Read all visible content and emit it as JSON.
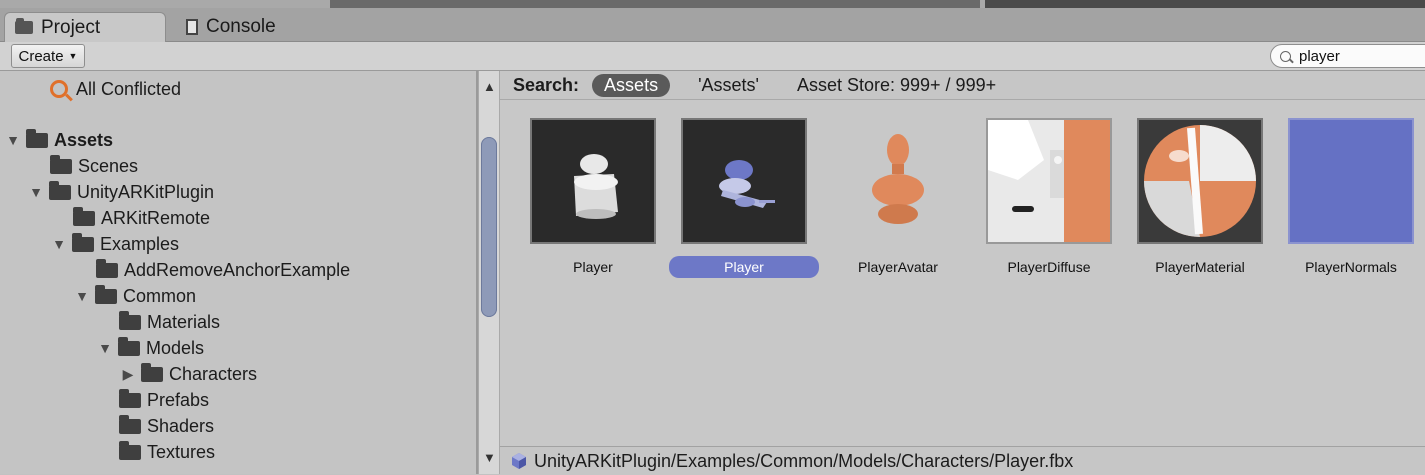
{
  "tabs": [
    {
      "label": "Project",
      "icon": "folder-icon",
      "active": true
    },
    {
      "label": "Console",
      "icon": "console-icon",
      "active": false
    }
  ],
  "toolbar": {
    "create_label": "Create",
    "search_value": "player"
  },
  "tree": {
    "conflicted": "All Conflicted",
    "items": [
      {
        "label": "Assets",
        "expanded": true
      },
      {
        "label": "Scenes"
      },
      {
        "label": "UnityARKitPlugin",
        "expanded": true
      },
      {
        "label": "ARKitRemote"
      },
      {
        "label": "Examples",
        "expanded": true
      },
      {
        "label": "AddRemoveAnchorExample"
      },
      {
        "label": "Common",
        "expanded": true
      },
      {
        "label": "Materials"
      },
      {
        "label": "Models",
        "expanded": true
      },
      {
        "label": "Characters",
        "expanded": false
      },
      {
        "label": "Prefabs"
      },
      {
        "label": "Shaders"
      },
      {
        "label": "Textures"
      }
    ]
  },
  "search_bar": {
    "label": "Search:",
    "scope_active": "Assets",
    "scope_quoted": "'Assets'",
    "asset_store": "Asset Store: 999+ / 999+"
  },
  "assets": [
    {
      "name": "Player",
      "selected": false
    },
    {
      "name": "Player",
      "selected": true
    },
    {
      "name": "PlayerAvatar",
      "selected": false
    },
    {
      "name": "PlayerDiffuse",
      "selected": false
    },
    {
      "name": "PlayerMaterial",
      "selected": false
    },
    {
      "name": "PlayerNormals",
      "selected": false
    }
  ],
  "footer": {
    "path": "UnityARKitPlugin/Examples/Common/Models/Characters/Player.fbx"
  },
  "colors": {
    "selection": "#6d78c7",
    "conflict_accent": "#e0702a",
    "normals_blue": "#6571c4",
    "diffuse_orange": "#e0895c"
  }
}
